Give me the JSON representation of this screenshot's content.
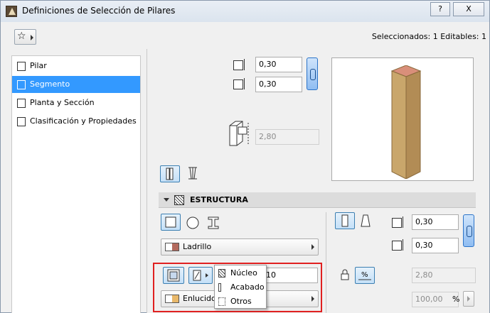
{
  "window": {
    "title": "Definiciones de Selección de Pilares",
    "help_label": "?",
    "close_label": "X"
  },
  "header": {
    "favorites_icon": "star-icon",
    "selection_info": "Seleccionados: 1 Editables: 1"
  },
  "sidebar": {
    "items": [
      {
        "label": "Pilar",
        "icon": "column-icon",
        "active": false
      },
      {
        "label": "Segmento",
        "icon": "segment-icon",
        "active": true
      },
      {
        "label": "Planta y Sección",
        "icon": "floorplan-icon",
        "active": false
      },
      {
        "label": "Clasificación y Propiedades",
        "icon": "properties-icon",
        "active": false
      }
    ]
  },
  "dimensions": {
    "width": "0,30",
    "depth": "0,30",
    "height": "2,80"
  },
  "structure": {
    "title": "ESTRUCTURA",
    "building_material": "Ladrillo",
    "material_color": "#b36a5e",
    "core_value_partial": "10",
    "finish_material": "Enlucido",
    "finish_color": "#e8b86a",
    "right_width": "0,30",
    "right_depth": "0,30",
    "angle_value": "2,80",
    "percent_value": "100,00",
    "percent_unit": "%"
  },
  "popup_menu": {
    "items": [
      {
        "label": "Núcleo"
      },
      {
        "label": "Acabado"
      },
      {
        "label": "Otros"
      }
    ]
  },
  "colors": {
    "accent": "#3399ff",
    "highlight_box": "#e02020",
    "column_wood": "#c9a66b"
  }
}
